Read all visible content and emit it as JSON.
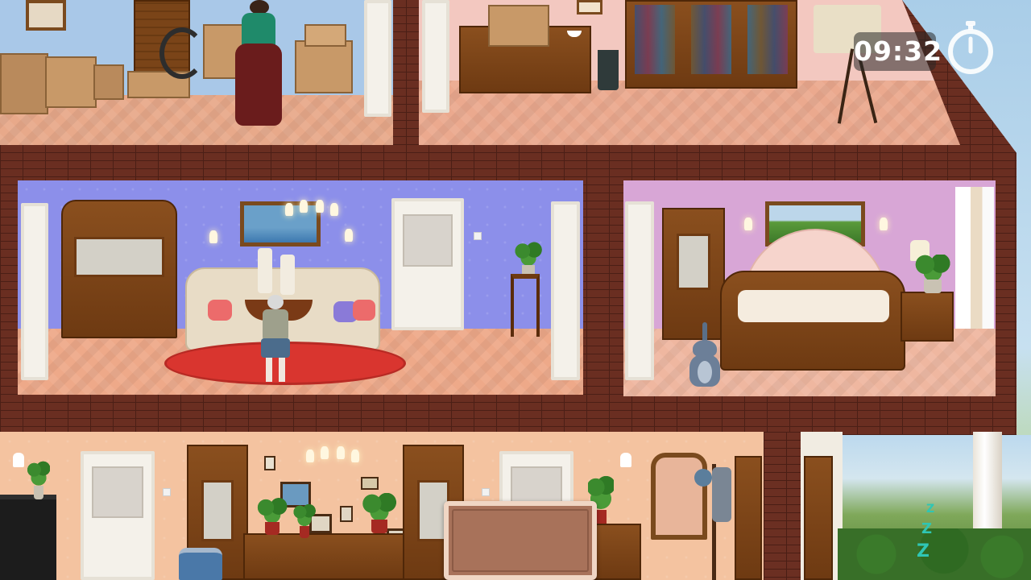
{
  "hud": {
    "timer": "09:32",
    "timer_icon": "stopwatch-icon"
  },
  "scene": {
    "rooms": [
      "storage-room",
      "study-room",
      "living-room",
      "bedroom",
      "ground-floor-hall"
    ],
    "characters": [
      "woman-in-green",
      "grandma",
      "cat"
    ],
    "sleep_indicator": "Z Z Z"
  },
  "colors": {
    "brick": "#6a2e21",
    "living_wall": "#8c8fea",
    "bedroom_wall": "#d8a6d6",
    "hall_wall": "#f4c3a0",
    "timer_bg": "#3a3a3a",
    "rug": "#d9352f"
  }
}
